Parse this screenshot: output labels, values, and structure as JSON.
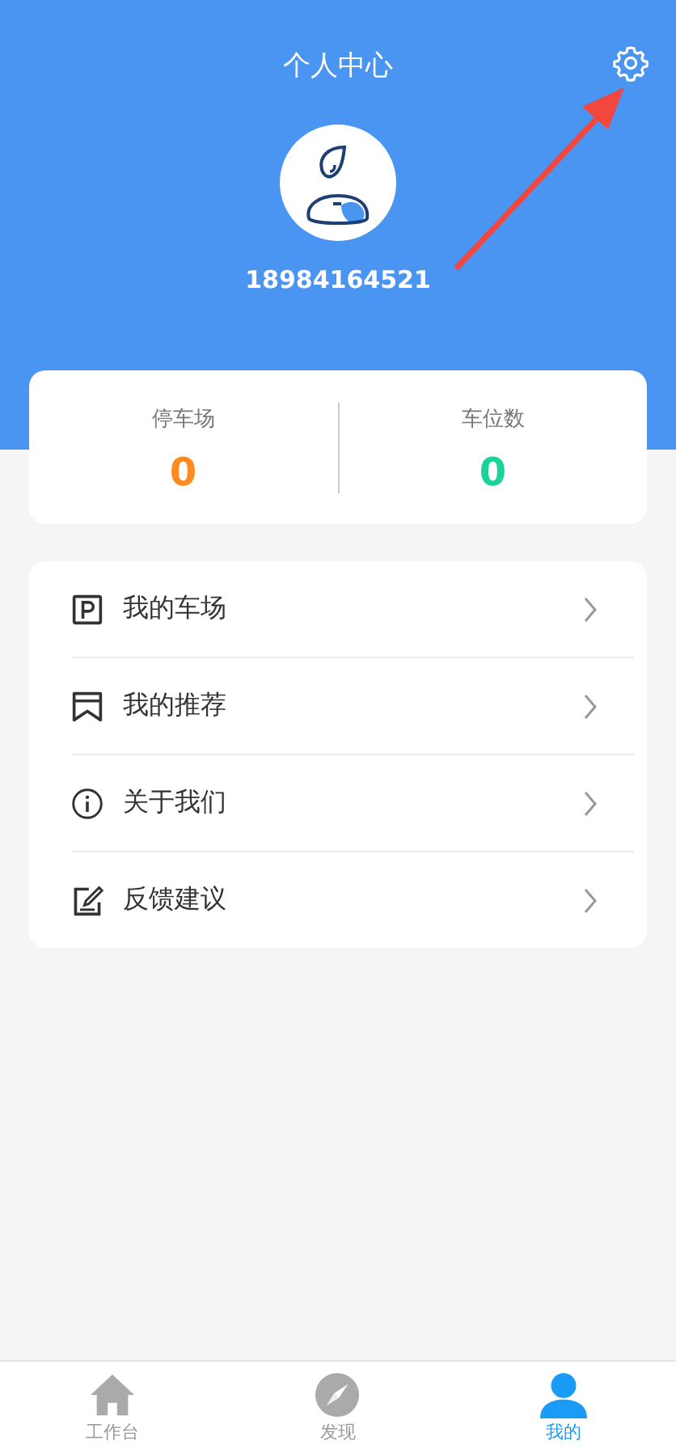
{
  "header": {
    "title": "个人中心",
    "phone": "18984164521"
  },
  "stats": [
    {
      "label": "停车场",
      "value": "0",
      "color": "#ff8a1f"
    },
    {
      "label": "车位数",
      "value": "0",
      "color": "#19d39a"
    }
  ],
  "menu": [
    {
      "kind": "parking",
      "label": "我的车场"
    },
    {
      "kind": "bookmark",
      "label": "我的推荐"
    },
    {
      "kind": "info",
      "label": "关于我们"
    },
    {
      "kind": "edit",
      "label": "反馈建议"
    }
  ],
  "tabs": [
    {
      "kind": "home",
      "label": "工作台",
      "selected": false
    },
    {
      "kind": "compass",
      "label": "发现",
      "selected": false
    },
    {
      "kind": "person",
      "label": "我的",
      "selected": true
    }
  ]
}
